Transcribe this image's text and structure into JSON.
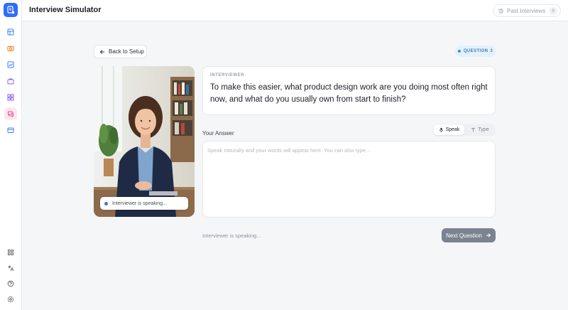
{
  "header": {
    "title": "Interview Simulator",
    "past_interviews_label": "Past Interviews",
    "past_interviews_count": "0"
  },
  "sidebar": {
    "items": [
      {
        "icon": "layout-icon",
        "color": "#3b82f6"
      },
      {
        "icon": "camera-icon",
        "color": "#f97316"
      },
      {
        "icon": "chart-icon",
        "color": "#3b82f6"
      },
      {
        "icon": "briefcase-icon",
        "color": "#8b5cf6"
      },
      {
        "icon": "grid-icon",
        "color": "#8b5cf6"
      },
      {
        "icon": "chat-icon",
        "color": "#ec4899",
        "active": true
      },
      {
        "icon": "card-icon",
        "color": "#3b82f6"
      }
    ],
    "bottom_items": [
      {
        "icon": "apps-icon"
      },
      {
        "icon": "translate-icon"
      },
      {
        "icon": "help-icon"
      },
      {
        "icon": "settings-icon"
      }
    ]
  },
  "main": {
    "back_label": "Back to Setup",
    "question_badge": {
      "label": "QUESTION",
      "number": "3"
    },
    "video": {
      "status": "Interviewer is speaking..."
    },
    "interviewer_card": {
      "label": "INTERVIEWER",
      "question": "To make this easier, what product design work are you doing most often right now, and what do you usually own from start to finish?"
    },
    "answer": {
      "label": "Your Answer",
      "modes": {
        "speak": "Speak",
        "type": "Type"
      },
      "placeholder": "Speak naturally and your words will appear here. You can also type..."
    },
    "status": "Interviewer is speaking...",
    "next_label": "Next Question"
  },
  "colors": {
    "accent": "#2f6df6",
    "badge_bg": "#e3f1fb",
    "next_button": "#7b8390"
  }
}
